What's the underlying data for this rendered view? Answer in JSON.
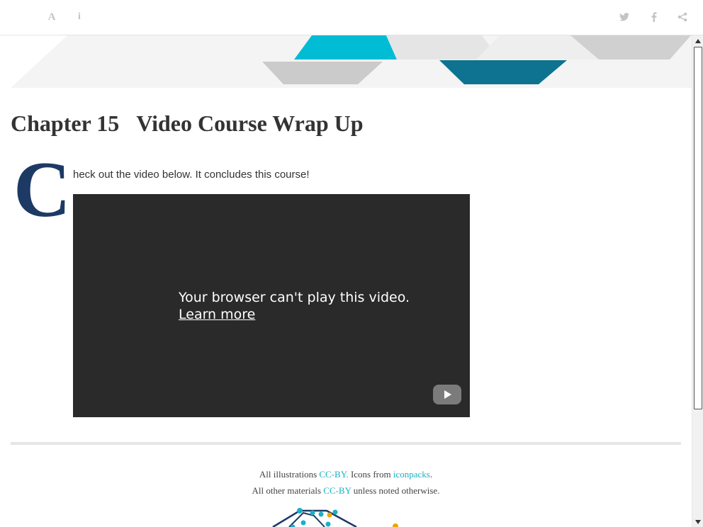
{
  "toolbar": {
    "font_icon": "A",
    "info_icon": "i",
    "icons": [
      "font-settings-icon",
      "info-icon",
      "twitter-icon",
      "facebook-icon",
      "share-icon"
    ]
  },
  "colors": {
    "banner_cyan": "#00bcd4",
    "banner_teal": "#0e7391",
    "banner_gray": "#c8c8c8",
    "dropcap": "#1d3a64",
    "link": "#1ab0c4"
  },
  "chapter": {
    "number": "Chapter 15",
    "title": "Video Course Wrap Up"
  },
  "body": {
    "dropcap": "C",
    "intro": "heck out the video below. It concludes this course!"
  },
  "video": {
    "message": "Your browser can't play this video.",
    "learn_more": "Learn more"
  },
  "footer": {
    "line1_prefix": "All illustrations ",
    "line1_link1": "CC-BY.",
    "line1_middle": " Icons from ",
    "line1_link2": "iconpacks",
    "line1_suffix": ".",
    "line2_prefix": "All other materials ",
    "line2_link": "CC-BY",
    "line2_suffix": " unless noted otherwise."
  }
}
